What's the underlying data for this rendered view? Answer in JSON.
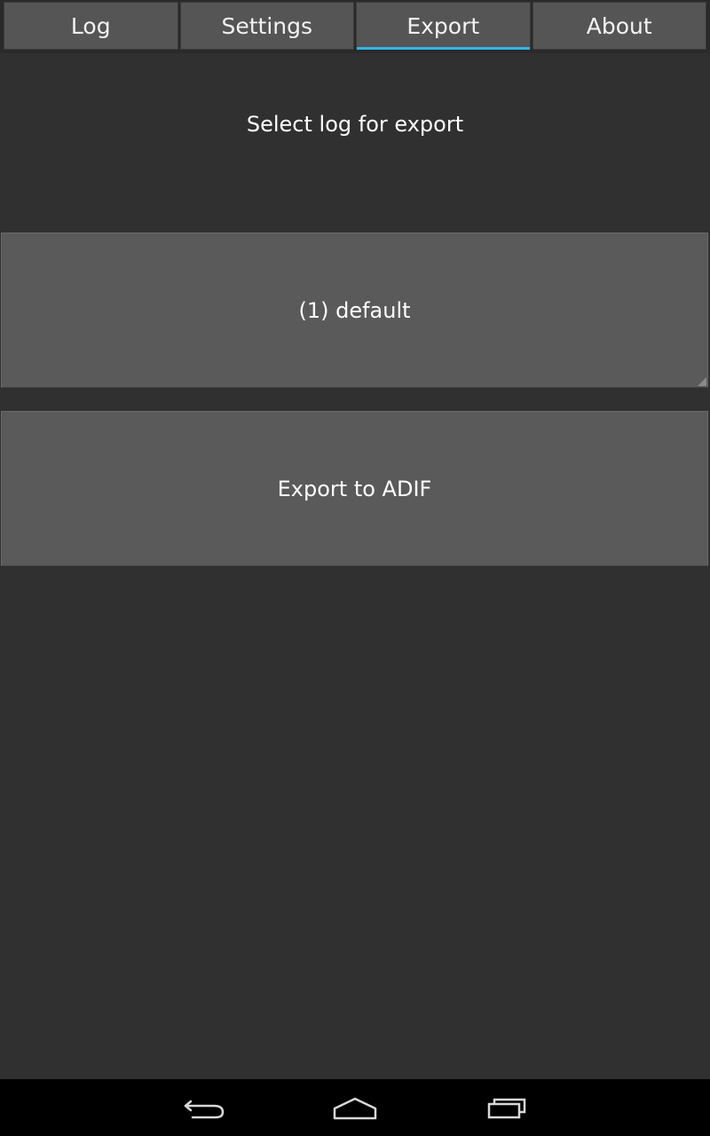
{
  "tabs": [
    {
      "label": "Log",
      "active": false
    },
    {
      "label": "Settings",
      "active": false
    },
    {
      "label": "Export",
      "active": true
    },
    {
      "label": "About",
      "active": false
    }
  ],
  "export": {
    "title": "Select log for export",
    "log_spinner_value": "(1) default",
    "export_button_label": "Export to ADIF"
  },
  "navbar": {
    "icons": [
      "back-icon",
      "home-icon",
      "recents-icon"
    ]
  },
  "colors": {
    "background": "#303030",
    "tab_background": "#555555",
    "accent": "#33b5e5",
    "button_background": "#5a5a5a",
    "navbar_background": "#000000"
  }
}
